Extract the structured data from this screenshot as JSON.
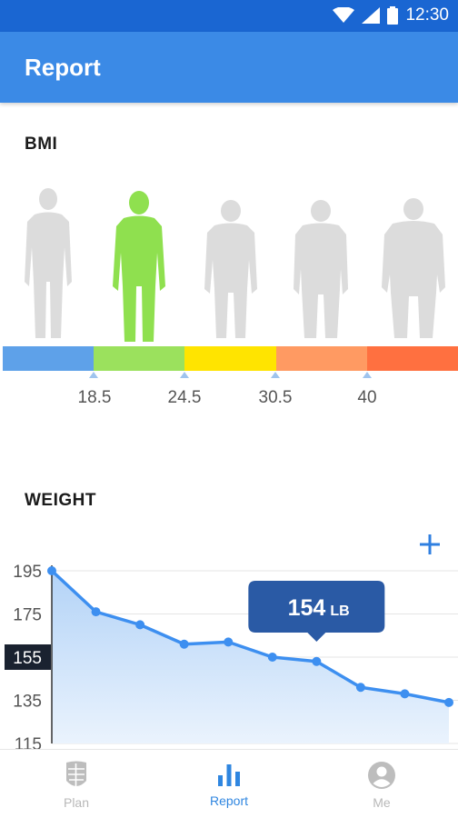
{
  "status_bar": {
    "time": "12:30"
  },
  "app_bar": {
    "title": "Report"
  },
  "bmi": {
    "title": "BMI",
    "selected_figure_index": 1,
    "segment_colors": [
      "#5ea1e9",
      "#9be15d",
      "#ffe400",
      "#ff9a62",
      "#ff7040"
    ],
    "ticks": [
      "18.5",
      "24.5",
      "30.5",
      "40"
    ]
  },
  "weight": {
    "title": "WEIGHT",
    "add_icon": "plus-icon",
    "callout_value": "154",
    "callout_unit": "LB",
    "current_axis_label": "155"
  },
  "chart_data": {
    "type": "area",
    "title": "",
    "xlabel": "",
    "ylabel": "",
    "ylim": [
      115,
      195
    ],
    "yticks": [
      "195",
      "175",
      "155",
      "135",
      "115"
    ],
    "highlighted_ytick": "155",
    "series": [
      {
        "values": [
          195,
          176,
          170,
          161,
          162,
          155,
          153,
          141,
          138,
          134
        ]
      }
    ],
    "highlighted_point_index": 6,
    "grid": true,
    "line_color": "#3d8ff0",
    "fill_color": "#bcd8f8"
  },
  "bottom_nav": {
    "items": [
      {
        "label": "Plan",
        "icon": "abs-icon",
        "active": false
      },
      {
        "label": "Report",
        "icon": "bar-chart-icon",
        "active": true
      },
      {
        "label": "Me",
        "icon": "account-icon",
        "active": false
      }
    ]
  }
}
